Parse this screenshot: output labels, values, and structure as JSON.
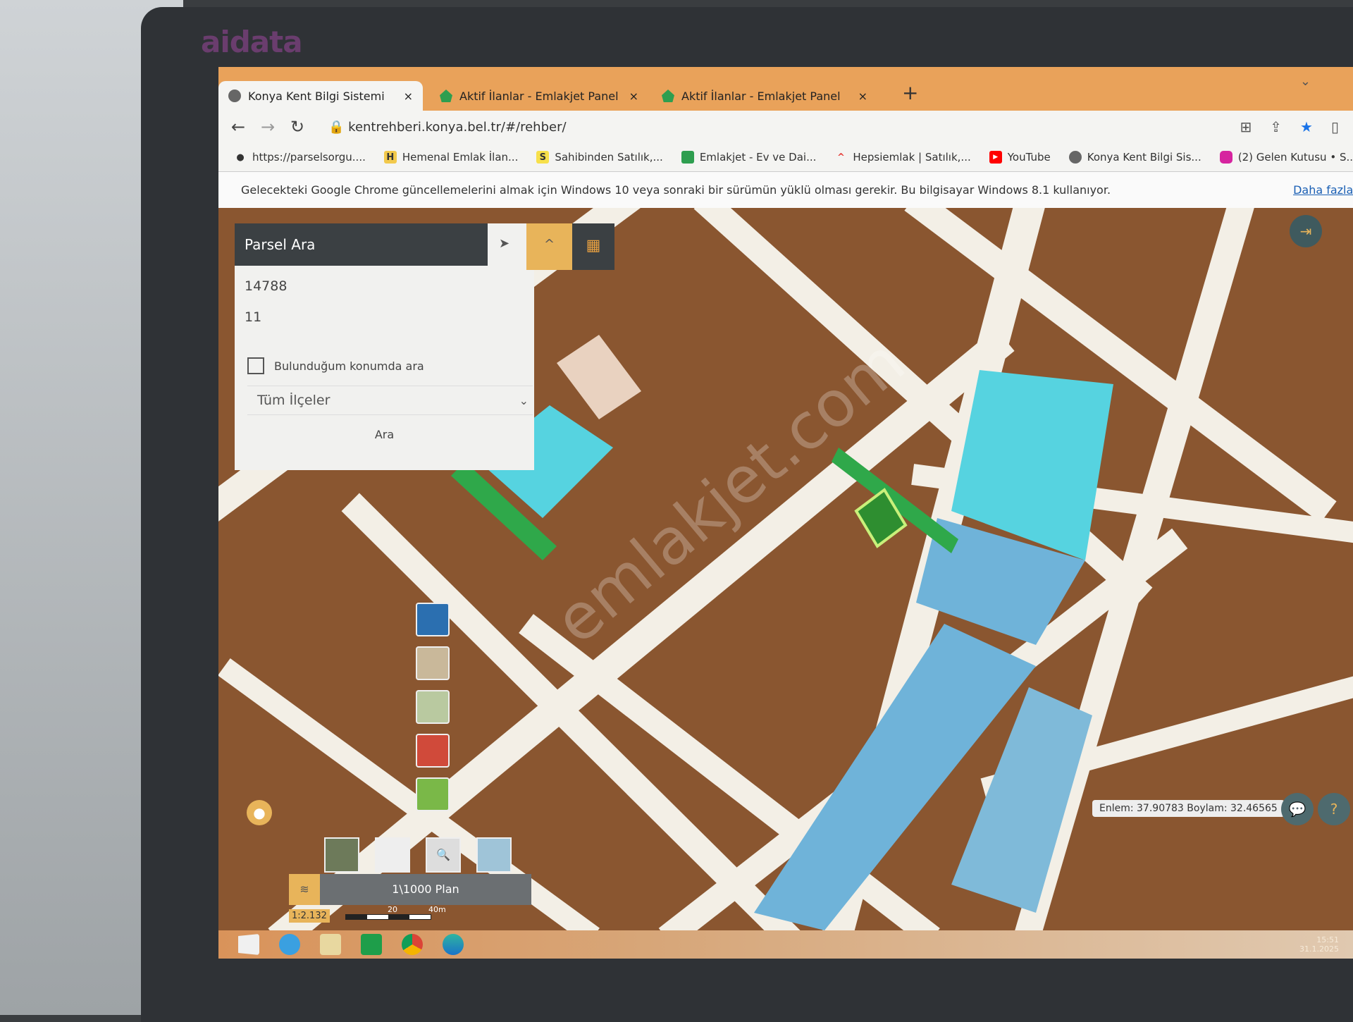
{
  "monitor_brand": "aidata",
  "browser": {
    "tabs": [
      {
        "title": "Konya Kent Bilgi Sistemi",
        "active": true,
        "icon": "konya-emblem-icon"
      },
      {
        "title": "Aktif İlanlar - Emlakjet Panel",
        "active": false,
        "icon": "emlakjet-icon"
      },
      {
        "title": "Aktif İlanlar - Emlakjet Panel",
        "active": false,
        "icon": "emlakjet-icon"
      }
    ],
    "close_glyph": "×",
    "new_tab_glyph": "+",
    "url": "kentrehberi.konya.bel.tr/#/rehber/",
    "bookmarks": [
      {
        "label": "https://parselsorgu....",
        "icon": "map-pin-icon",
        "badge": "",
        "color": "#333333"
      },
      {
        "label": "Hemenal Emlak İlan...",
        "icon": "hemenal-icon",
        "badge": "H",
        "color": "#f2c94c"
      },
      {
        "label": "Sahibinden Satılık,...",
        "icon": "sahibinden-icon",
        "badge": "S",
        "color": "#f7e04b"
      },
      {
        "label": "Emlakjet - Ev ve Dai...",
        "icon": "emlakjet-icon",
        "badge": "",
        "color": "#2e9e4f"
      },
      {
        "label": "Hepsiemlak | Satılık,...",
        "icon": "hepsiemlak-icon",
        "badge": "^",
        "color": "#e53935"
      },
      {
        "label": "YouTube",
        "icon": "youtube-icon",
        "badge": "▶",
        "color": "#ff0000"
      },
      {
        "label": "Konya Kent Bilgi Sis...",
        "icon": "konya-emblem-icon",
        "badge": "",
        "color": "#555555"
      },
      {
        "label": "(2) Gelen Kutusu • S...",
        "icon": "instagram-icon",
        "badge": "",
        "color": "#d6249f"
      }
    ],
    "infobar": {
      "message": "Gelecekteki Google Chrome güncellemelerini almak için Windows 10 veya sonraki bir sürümün yüklü olması gerekir. Bu bilgisayar Windows 8.1 kullanıyor.",
      "link": "Daha fazla bi"
    }
  },
  "parcel_search": {
    "title": "Parsel Ara",
    "block_value": "14788",
    "parcel_value": "11",
    "checkbox_label": "Bulunduğum konumda ara",
    "checkbox_checked": false,
    "district_select": "Tüm İlçeler",
    "submit": "Ara"
  },
  "map": {
    "layer_label": "1\\1000 Plan",
    "scale_ratio": "1:2.132",
    "scale_ticks": [
      "20",
      "40m"
    ],
    "coordinates": "Enlem: 37.90783 Boylam: 32.46565",
    "watermark": "emlakjet.com",
    "colors": {
      "residential": "#8a5630",
      "road": "#f3efe6",
      "public": "#6fb3d9",
      "education": "#56d3e0",
      "green": "#2fa84a",
      "accent": "#e8b45a"
    }
  },
  "taskbar": {
    "apps": [
      "windows-start-icon",
      "internet-explorer-icon",
      "file-explorer-icon",
      "store-icon",
      "chrome-icon",
      "edge-icon"
    ],
    "time": "15:51",
    "date": "31.1.2025"
  }
}
